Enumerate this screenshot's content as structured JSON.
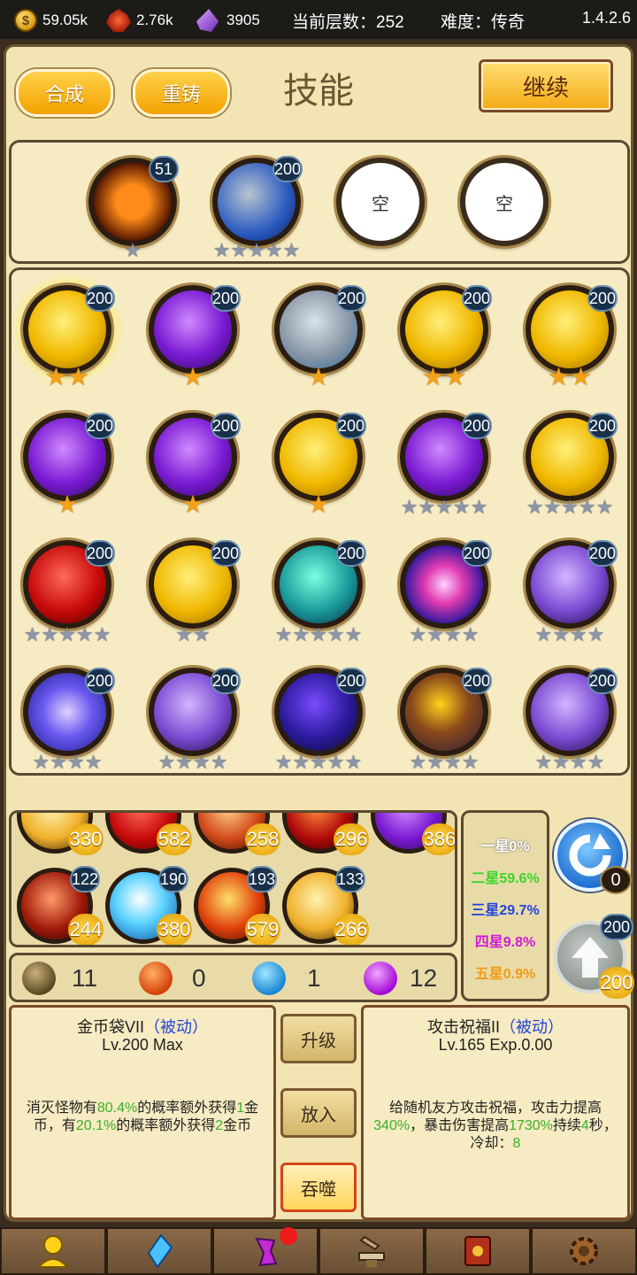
{
  "topbar": {
    "gold": "59.05k",
    "gem": "2.76k",
    "crystal": "3905",
    "floor": "当前层数：252",
    "difficulty": "难度：传奇",
    "version": "1.4.2.6"
  },
  "header": {
    "merge": "合成",
    "recast": "重铸",
    "title": "技能",
    "continue": "继续"
  },
  "equipped": [
    {
      "lvl": "51",
      "icon": "holy-cross-icon",
      "stars": "★",
      "color": "orange"
    },
    {
      "lvl": "200",
      "icon": "rock-water-icon",
      "stars": "★★★★★",
      "color": "silver"
    },
    {
      "label": "空"
    },
    {
      "label": "空"
    }
  ],
  "grid": [
    {
      "lvl": "200",
      "icon": "gold-bag-icon",
      "stars": "★★",
      "sc": "g"
    },
    {
      "lvl": "200",
      "icon": "lightning-icon",
      "stars": "★",
      "sc": "g"
    },
    {
      "lvl": "200",
      "icon": "stone-icon",
      "stars": "★",
      "sc": "g"
    },
    {
      "lvl": "200",
      "icon": "gold-bag-icon",
      "stars": "★★",
      "sc": "g"
    },
    {
      "lvl": "200",
      "icon": "gold-bag-icon",
      "stars": "★★",
      "sc": "g"
    },
    {
      "lvl": "200",
      "icon": "lightning-icon",
      "stars": "★",
      "sc": "g"
    },
    {
      "lvl": "200",
      "icon": "lightning-icon",
      "stars": "★",
      "sc": "g"
    },
    {
      "lvl": "200",
      "icon": "gold-bag-icon",
      "stars": "★",
      "sc": "g"
    },
    {
      "lvl": "200",
      "icon": "lightning-icon",
      "stars": "★★★★★",
      "sc": "s"
    },
    {
      "lvl": "200",
      "icon": "gold-bag-icon",
      "stars": "★★★★★",
      "sc": "s"
    },
    {
      "lvl": "200",
      "icon": "blood-drop-icon",
      "stars": "★★★★★",
      "sc": "s"
    },
    {
      "lvl": "200",
      "icon": "gold-bag-icon",
      "stars": "★★",
      "sc": "s"
    },
    {
      "lvl": "200",
      "icon": "wind-slash-icon",
      "stars": "★★★★★",
      "sc": "s"
    },
    {
      "lvl": "200",
      "icon": "energy-burst-icon",
      "stars": "★★★★",
      "sc": "s"
    },
    {
      "lvl": "200",
      "icon": "spirit-dance-icon",
      "stars": "★★★★",
      "sc": "s"
    },
    {
      "lvl": "200",
      "icon": "vortex-icon",
      "stars": "★★★★",
      "sc": "s"
    },
    {
      "lvl": "200",
      "icon": "spirit-dance-icon",
      "stars": "★★★★",
      "sc": "s"
    },
    {
      "lvl": "200",
      "icon": "dark-void-icon",
      "stars": "★★★★★",
      "sc": "s"
    },
    {
      "lvl": "200",
      "icon": "magma-icon",
      "stars": "★★★★",
      "sc": "s"
    },
    {
      "lvl": "200",
      "icon": "spirit-dance-icon",
      "stars": "★★★★",
      "sc": "s"
    }
  ],
  "inventory": [
    {
      "count": "330",
      "icon": "shadow-beast-icon"
    },
    {
      "count": "582",
      "icon": "blood-drop-icon"
    },
    {
      "count": "258",
      "icon": "fire-mask-icon"
    },
    {
      "count": "296",
      "icon": "flame-slash-icon"
    },
    {
      "count": "386",
      "icon": "lightning-icon"
    },
    {
      "lvl": "122",
      "count": "244",
      "icon": "red-blade-icon"
    },
    {
      "lvl": "190",
      "count": "380",
      "icon": "ice-burst-icon"
    },
    {
      "lvl": "193",
      "count": "579",
      "icon": "flame-burst-icon"
    },
    {
      "lvl": "133",
      "count": "266",
      "icon": "shadow-beast-icon"
    }
  ],
  "probabilities": [
    {
      "text": "一星0%",
      "color": "#ffffff"
    },
    {
      "text": "二星59.6%",
      "color": "#3ad62a"
    },
    {
      "text": "三星29.7%",
      "color": "#2244dd"
    },
    {
      "text": "四星9.8%",
      "color": "#d21ad6"
    },
    {
      "text": "五星0.9%",
      "color": "#f39a14"
    }
  ],
  "side": {
    "refresh_count": "0",
    "upgrade_lvl": "200",
    "upgrade_cost": "200"
  },
  "resources": [
    {
      "count": "11",
      "icon": "earth-orb-icon"
    },
    {
      "count": "0",
      "icon": "fire-orb-icon"
    },
    {
      "count": "1",
      "icon": "water-orb-icon"
    },
    {
      "count": "12",
      "icon": "arcane-orb-icon"
    }
  ],
  "left_card": {
    "name": "金币袋VII",
    "type": "（被动）",
    "level": "Lv.200 Max",
    "desc": [
      {
        "t": "消灭怪物有"
      },
      {
        "t": "80.4%",
        "g": true
      },
      {
        "t": "的概率额外获得"
      },
      {
        "t": "1",
        "g": true
      },
      {
        "t": "金币，有"
      },
      {
        "t": "20.1%",
        "g": true
      },
      {
        "t": "的概率额外获得"
      },
      {
        "t": "2",
        "g": true
      },
      {
        "t": "金币"
      }
    ]
  },
  "right_card": {
    "name": "攻击祝福II",
    "type": "（被动）",
    "level": "Lv.165 Exp.0.00",
    "desc": [
      {
        "t": "给随机友方攻击祝福，攻击力提高"
      },
      {
        "t": "340%",
        "g": true
      },
      {
        "t": "，暴击伤害提高"
      },
      {
        "t": "1730%",
        "g": true
      },
      {
        "t": "持续"
      },
      {
        "t": "4",
        "g": true
      },
      {
        "t": "秒，冷却："
      },
      {
        "t": "8",
        "g": true
      }
    ]
  },
  "actions": {
    "upgrade": "升级",
    "put_in": "放入",
    "devour": "吞噬"
  },
  "bottom_tabs": [
    "hero-icon",
    "gem-crystal-icon",
    "rune-icon",
    "forge-anvil-icon",
    "spellbook-icon",
    "gear-cog-icon"
  ]
}
